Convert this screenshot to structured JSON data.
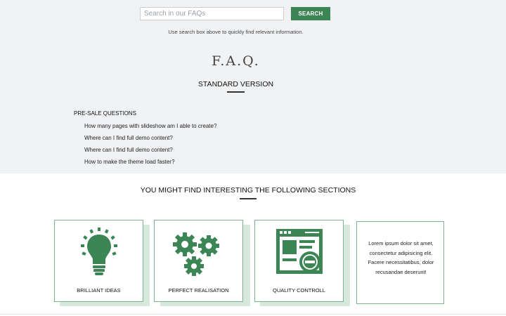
{
  "search": {
    "placeholder": "Search in our FAQs",
    "button_label": "SEARCH",
    "hint": "Use search box above to quickly find relevant information."
  },
  "faq": {
    "title": "F.A.Q.",
    "subtitle": "STANDARD VERSION",
    "section_label": "PRE-SALE QUESTIONS",
    "questions": [
      "How many pages with slideshow am I able to create?",
      "Where can I find full demo content?",
      "Where can I find full demo content?",
      "How to make the theme load faster?"
    ]
  },
  "sections": {
    "heading": "YOU MIGHT FIND INTERESTING THE FOLLOWING SECTIONS",
    "cards": [
      {
        "label": "BRILLIANT IDEAS",
        "icon": "lightbulb-icon"
      },
      {
        "label": "PERFECT REALISATION",
        "icon": "gears-icon"
      },
      {
        "label": "QUALITY CONTROLL",
        "icon": "browser-window-icon"
      }
    ],
    "text_card": "Lorem ipsum dolor sit amet, consectetur adipisicing elit. Facere necessitatibus, dolor recusandae deserunt!"
  },
  "colors": {
    "accent": "#3c8656",
    "card_border": "#7ab38f",
    "card_shadow": "#d9e8dc",
    "top_background": "#f1f2f4"
  }
}
